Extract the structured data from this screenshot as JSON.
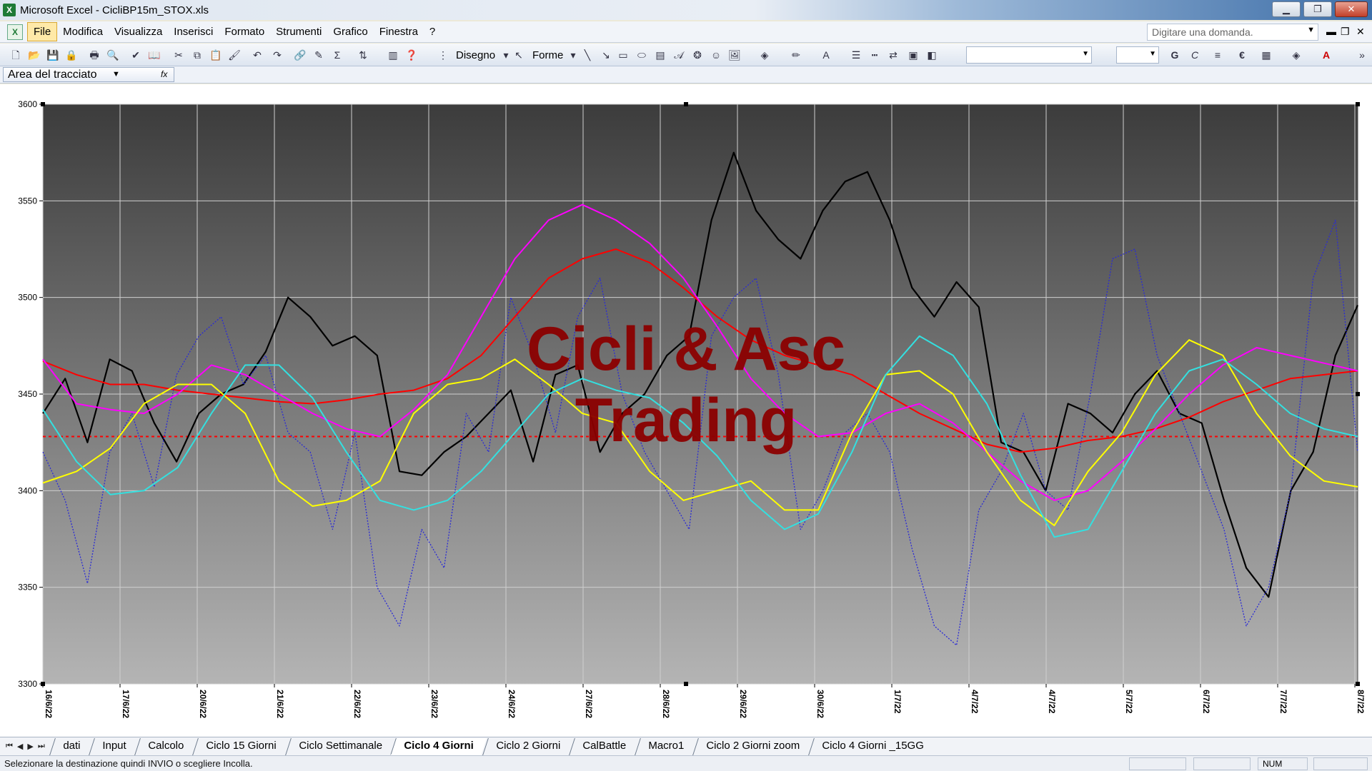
{
  "window": {
    "title": "Microsoft Excel - CicliBP15m_STOX.xls",
    "app_icon": "excel-icon",
    "minimize": "▁",
    "restore": "❐",
    "close": "✕"
  },
  "menubar": {
    "items": [
      "File",
      "Modifica",
      "Visualizza",
      "Inserisci",
      "Formato",
      "Strumenti",
      "Grafico",
      "Finestra",
      "?"
    ],
    "ask_placeholder": "Digitare una domanda.",
    "mdi_min": "▬",
    "mdi_restore": "❐",
    "mdi_close": "✕"
  },
  "toolbar": {
    "draw_label": "Disegno",
    "shapes_label": "Forme",
    "bold_glyph": "G",
    "italic_glyph": "C",
    "euro_glyph": "€",
    "font_color_glyph": "A"
  },
  "namebox": {
    "value": "Area del tracciato",
    "fx": "fx"
  },
  "chart_data": {
    "type": "line",
    "ylim": [
      3300,
      3600
    ],
    "yticks": [
      3300,
      3350,
      3400,
      3450,
      3500,
      3550,
      3600
    ],
    "x_labels": [
      "16/6/22",
      "17/6/22",
      "20/6/22",
      "21/6/22",
      "22/6/22",
      "23/6/22",
      "24/6/22",
      "27/6/22",
      "28/6/22",
      "29/6/22",
      "30/6/22",
      "1/7/22",
      "4/7/22",
      "4/7/22",
      "5/7/22",
      "6/7/22",
      "7/7/22",
      "8/7/22"
    ],
    "n_points": 60,
    "reference_level": 3428,
    "watermark": [
      "Cicli & Asc",
      "Trading"
    ],
    "background": {
      "top": "#3c3c3c",
      "bottom": "#b4b4b4"
    },
    "series": [
      {
        "color": "#000000",
        "style": "solid",
        "width": 2.2,
        "values": [
          3440,
          3458,
          3425,
          3468,
          3462,
          3435,
          3415,
          3440,
          3450,
          3455,
          3472,
          3500,
          3490,
          3475,
          3480,
          3470,
          3410,
          3408,
          3420,
          3428,
          3440,
          3452,
          3415,
          3460,
          3465,
          3420,
          3440,
          3450,
          3470,
          3480,
          3540,
          3575,
          3545,
          3530,
          3520,
          3545,
          3560,
          3565,
          3540,
          3505,
          3490,
          3508,
          3495,
          3425,
          3420,
          3400,
          3445,
          3440,
          3430,
          3450,
          3462,
          3440,
          3435,
          3395,
          3360,
          3345,
          3400,
          3420,
          3470,
          3496
        ]
      },
      {
        "color": "#2a2ad6",
        "style": "dotted",
        "width": 1.3,
        "values": [
          3420,
          3395,
          3352,
          3420,
          3440,
          3402,
          3460,
          3480,
          3490,
          3455,
          3470,
          3430,
          3420,
          3380,
          3430,
          3350,
          3330,
          3380,
          3360,
          3440,
          3420,
          3500,
          3470,
          3430,
          3490,
          3510,
          3450,
          3420,
          3400,
          3380,
          3480,
          3500,
          3510,
          3460,
          3380,
          3400,
          3430,
          3440,
          3420,
          3370,
          3330,
          3320,
          3390,
          3410,
          3440,
          3400,
          3390,
          3450,
          3520,
          3525,
          3470,
          3440,
          3410,
          3380,
          3330,
          3350,
          3400,
          3510,
          3540,
          3420
        ]
      },
      {
        "color": "#ff0000",
        "style": "solid",
        "width": 2,
        "values": [
          3467,
          3460,
          3455,
          3455,
          3452,
          3450,
          3448,
          3446,
          3445,
          3447,
          3450,
          3452,
          3458,
          3470,
          3490,
          3510,
          3520,
          3525,
          3518,
          3505,
          3490,
          3478,
          3470,
          3465,
          3460,
          3450,
          3440,
          3432,
          3424,
          3420,
          3422,
          3426,
          3428,
          3432,
          3438,
          3446,
          3452,
          3458,
          3460,
          3462
        ]
      },
      {
        "color": "#ff00ff",
        "style": "solid",
        "width": 2,
        "values": [
          3468,
          3445,
          3442,
          3440,
          3450,
          3465,
          3460,
          3450,
          3440,
          3432,
          3428,
          3442,
          3460,
          3490,
          3520,
          3540,
          3548,
          3540,
          3528,
          3510,
          3485,
          3458,
          3440,
          3428,
          3430,
          3440,
          3445,
          3435,
          3420,
          3405,
          3395,
          3400,
          3415,
          3432,
          3450,
          3465,
          3474,
          3470,
          3466,
          3462
        ]
      },
      {
        "color": "#ffff00",
        "style": "solid",
        "width": 2,
        "values": [
          3404,
          3410,
          3422,
          3445,
          3455,
          3455,
          3440,
          3405,
          3392,
          3395,
          3405,
          3440,
          3455,
          3458,
          3468,
          3455,
          3440,
          3435,
          3410,
          3395,
          3400,
          3405,
          3390,
          3390,
          3430,
          3460,
          3462,
          3450,
          3420,
          3395,
          3382,
          3410,
          3430,
          3460,
          3478,
          3470,
          3440,
          3418,
          3405,
          3402
        ]
      },
      {
        "color": "#33e0e0",
        "style": "solid",
        "width": 2,
        "values": [
          3442,
          3415,
          3398,
          3400,
          3412,
          3440,
          3465,
          3465,
          3448,
          3420,
          3395,
          3390,
          3395,
          3410,
          3430,
          3450,
          3458,
          3452,
          3448,
          3435,
          3418,
          3395,
          3380,
          3388,
          3420,
          3460,
          3480,
          3470,
          3445,
          3408,
          3376,
          3380,
          3410,
          3440,
          3462,
          3468,
          3455,
          3440,
          3432,
          3428
        ]
      }
    ]
  },
  "sheet_tabs": {
    "items": [
      "dati",
      "Input",
      "Calcolo",
      "Ciclo 15 Giorni",
      "Ciclo Settimanale",
      "Ciclo 4 Giorni",
      "Ciclo 2 Giorni",
      "CalBattle",
      "Macro1",
      "Ciclo 2 Giorni zoom",
      "Ciclo 4 Giorni _15GG"
    ],
    "active_index": 5
  },
  "statusbar": {
    "message": "Selezionare la destinazione quindi INVIO o scegliere Incolla.",
    "num": "NUM"
  }
}
